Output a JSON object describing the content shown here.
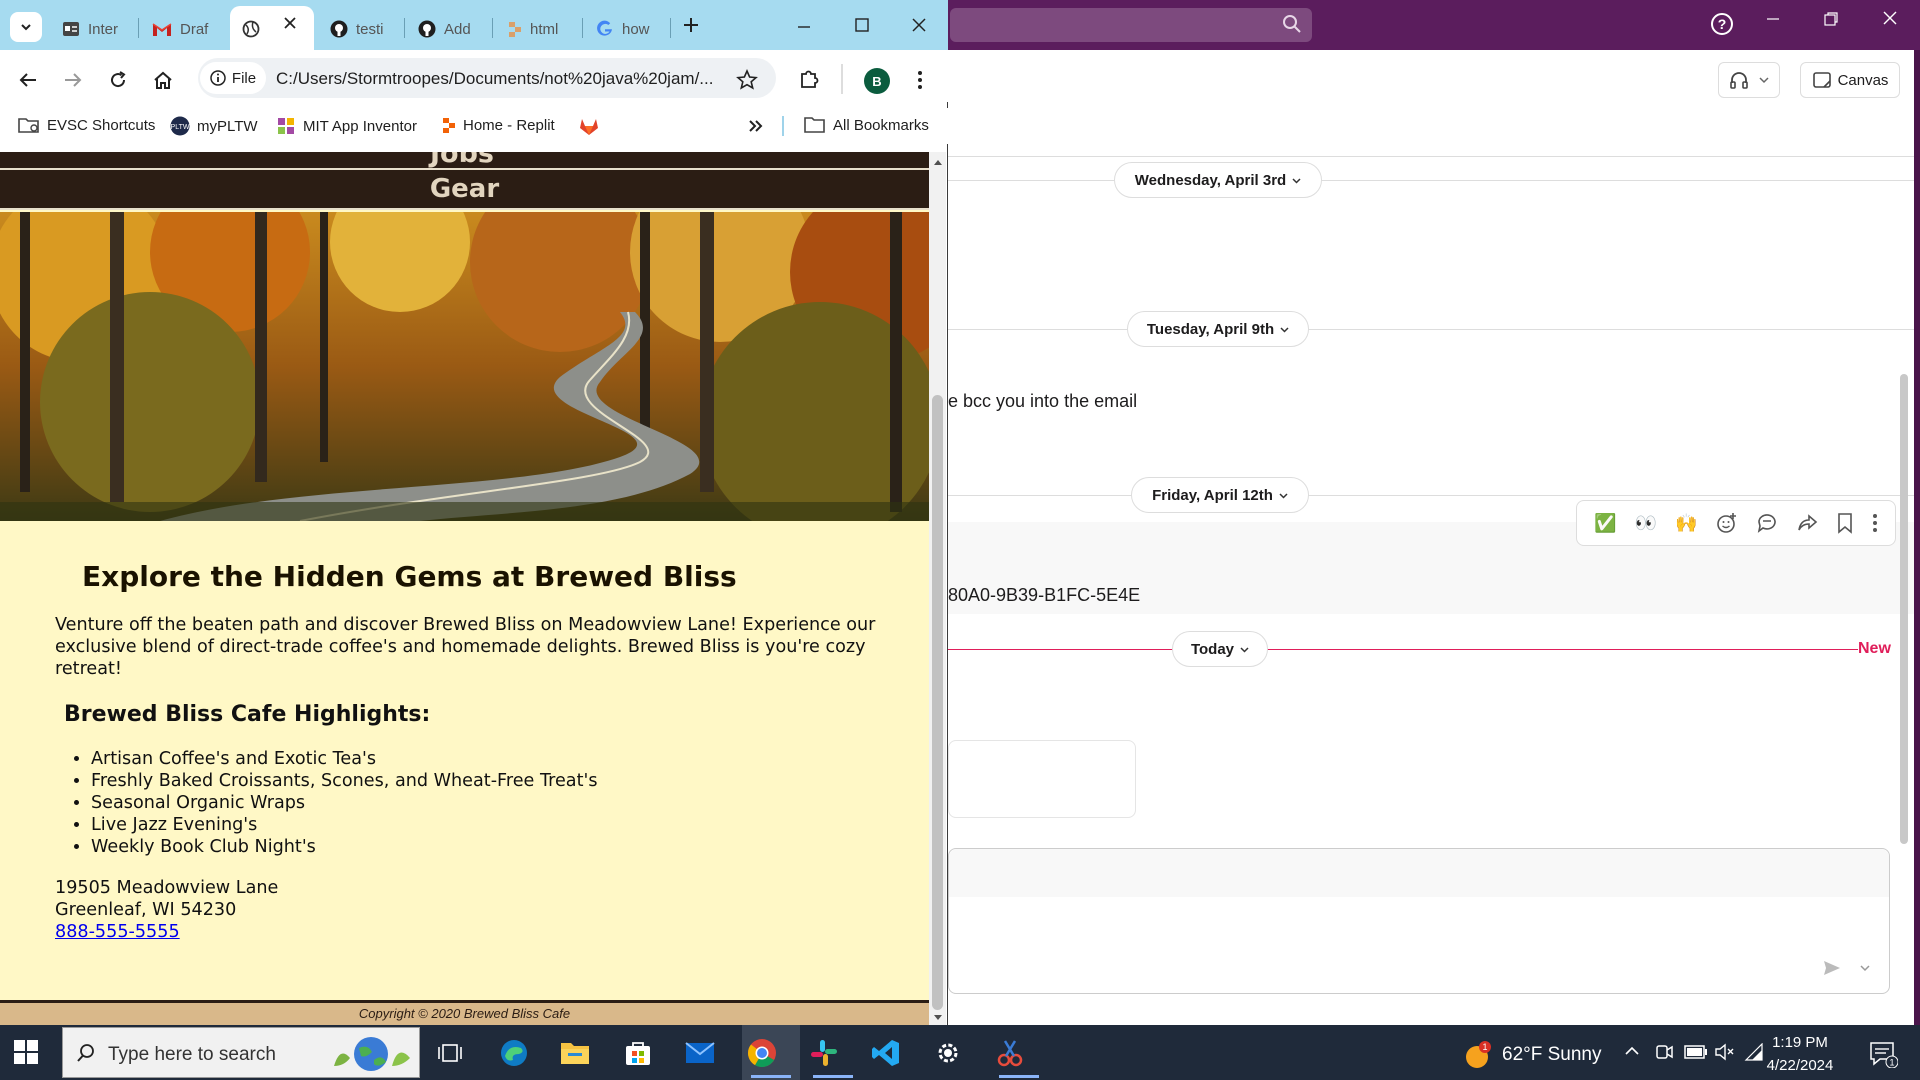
{
  "chrome": {
    "tabs": [
      {
        "label": "Inter",
        "icon": "tab-favicon"
      },
      {
        "label": "Draf",
        "icon": "gmail-icon"
      },
      {
        "label": "",
        "icon": "globe-icon",
        "active": true
      },
      {
        "label": "testi",
        "icon": "github-icon"
      },
      {
        "label": "Add",
        "icon": "github-icon"
      },
      {
        "label": "html",
        "icon": "replit-icon"
      },
      {
        "label": "how",
        "icon": "google-icon"
      }
    ],
    "address": {
      "chip_label": "File",
      "url": "C:/Users/Stormtroopes/Documents/not%20java%20jam/..."
    },
    "profile_initial": "B",
    "bookmarks": [
      {
        "label": "EVSC Shortcuts"
      },
      {
        "label": "myPLTW"
      },
      {
        "label": "MIT App Inventor"
      },
      {
        "label": "Home - Replit"
      }
    ],
    "all_bookmarks_label": "All Bookmarks"
  },
  "page": {
    "nav_partial": "Jobs",
    "nav_gear": "Gear",
    "heading": "Explore the Hidden Gems at Brewed Bliss",
    "intro": "Venture off the beaten path and discover Brewed Bliss on Meadowview Lane! Experience our exclusive blend of direct-trade coffee's and homemade delights. Brewed Bliss is you're cozy retreat!",
    "highlights_heading": "Brewed Bliss Cafe Highlights:",
    "highlights": [
      "Artisan Coffee's and Exotic Tea's",
      "Freshly Baked Croissants, Scones, and Wheat-Free Treat's",
      "Seasonal Organic Wraps",
      "Live Jazz Evening's",
      "Weekly Book Club Night's"
    ],
    "address_line1": "19505 Meadowview Lane",
    "address_line2": "Greenleaf, WI 54230",
    "phone": "888-555-5555",
    "footer": "Copyright © 2020 Brewed Bliss Cafe"
  },
  "slack": {
    "canvas_label": "Canvas",
    "dates": [
      "Wednesday, April 3rd",
      "Tuesday, April 9th",
      "Friday, April 12th",
      "Today"
    ],
    "messages": [
      "e bcc you into the email",
      "80A0-9B39-B1FC-5E4E"
    ],
    "new_label": "New",
    "reactions": [
      "✅",
      "👀",
      "🙌"
    ]
  },
  "taskbar": {
    "search_placeholder": "Type here to search",
    "weather": "62°F  Sunny",
    "weather_badge": "1",
    "time": "1:19 PM",
    "date": "4/22/2024",
    "notification_count": "1"
  },
  "colors": {
    "slack_purple": "#4a154b",
    "chrome_tabstrip": "#a6dbf0",
    "page_background": "#fff8c6",
    "nav_dark": "#2b1d14",
    "footer_tan": "#d9b88a",
    "slack_new_red": "#e01e5a"
  }
}
